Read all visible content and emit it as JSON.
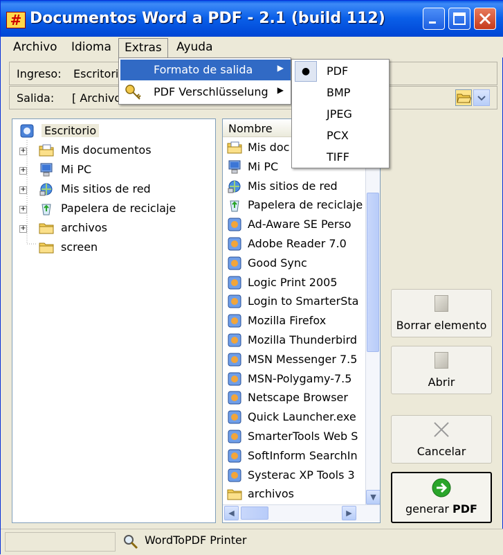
{
  "window": {
    "title": "Documentos Word a PDF - 2.1 (build 112)"
  },
  "menubar": {
    "items": [
      "Archivo",
      "Idioma",
      "Extras",
      "Ayuda"
    ]
  },
  "input_row": {
    "label": "Ingreso:",
    "value": "Escritorio"
  },
  "output_row": {
    "label": "Salida:",
    "value": "[ Archivo"
  },
  "extras_menu": {
    "items": [
      {
        "label": "Formato de salida",
        "icon": "none",
        "has_submenu": true
      },
      {
        "label": "PDF Verschlüsselung",
        "icon": "key-icon",
        "has_submenu": true
      }
    ]
  },
  "format_submenu": {
    "selected": "PDF",
    "items": [
      "PDF",
      "BMP",
      "JPEG",
      "PCX",
      "TIFF"
    ]
  },
  "tree": {
    "root": "Escritorio",
    "items": [
      {
        "label": "Mis documentos",
        "icon": "documents-folder-icon"
      },
      {
        "label": "Mi PC",
        "icon": "computer-icon"
      },
      {
        "label": "Mis sitios de red",
        "icon": "network-icon"
      },
      {
        "label": "Papelera de reciclaje",
        "icon": "recycle-bin-icon"
      },
      {
        "label": "archivos",
        "icon": "folder-icon"
      },
      {
        "label": "screen",
        "icon": "folder-icon"
      }
    ]
  },
  "file_list": {
    "column_header": "Nombre",
    "items": [
      "Mis documentos",
      "Mi PC",
      "Mis sitios de red",
      "Papelera de reciclaje",
      "Ad-Aware SE Personal",
      "Adobe Reader 7.0",
      "Good Sync",
      "Logic Print 2005",
      "Login to SmarterStats",
      "Mozilla Firefox",
      "Mozilla Thunderbird",
      "MSN Messenger 7.5",
      "MSN-Polygamy-7.5",
      "Netscape Browser",
      "Quick Launcher.exe",
      "SmarterTools Web Server",
      "SoftInform SearchInform",
      "Systerac XP Tools 3",
      "archivos"
    ],
    "visible_texts": [
      "Mis doc",
      "Mi PC",
      "Mis sitios de red",
      "Papelera de reciclaje",
      "Ad-Aware SE Perso",
      "Adobe Reader 7.0",
      "Good Sync",
      "Logic Print 2005",
      "Login to SmarterSta",
      "Mozilla Firefox",
      "Mozilla Thunderbird",
      "MSN Messenger 7.5",
      "MSN-Polygamy-7.5",
      "Netscape Browser",
      "Quick Launcher.exe",
      "SmarterTools Web S",
      "SoftInform SearchIn",
      "Systerac XP Tools 3",
      "archivos"
    ]
  },
  "buttons": {
    "delete": "Borrar elemento",
    "open": "Abrir",
    "cancel": "Cancelar",
    "generate_prefix": "generar",
    "generate_bold": "PDF"
  },
  "statusbar": {
    "printer": "WordToPDF Printer"
  }
}
